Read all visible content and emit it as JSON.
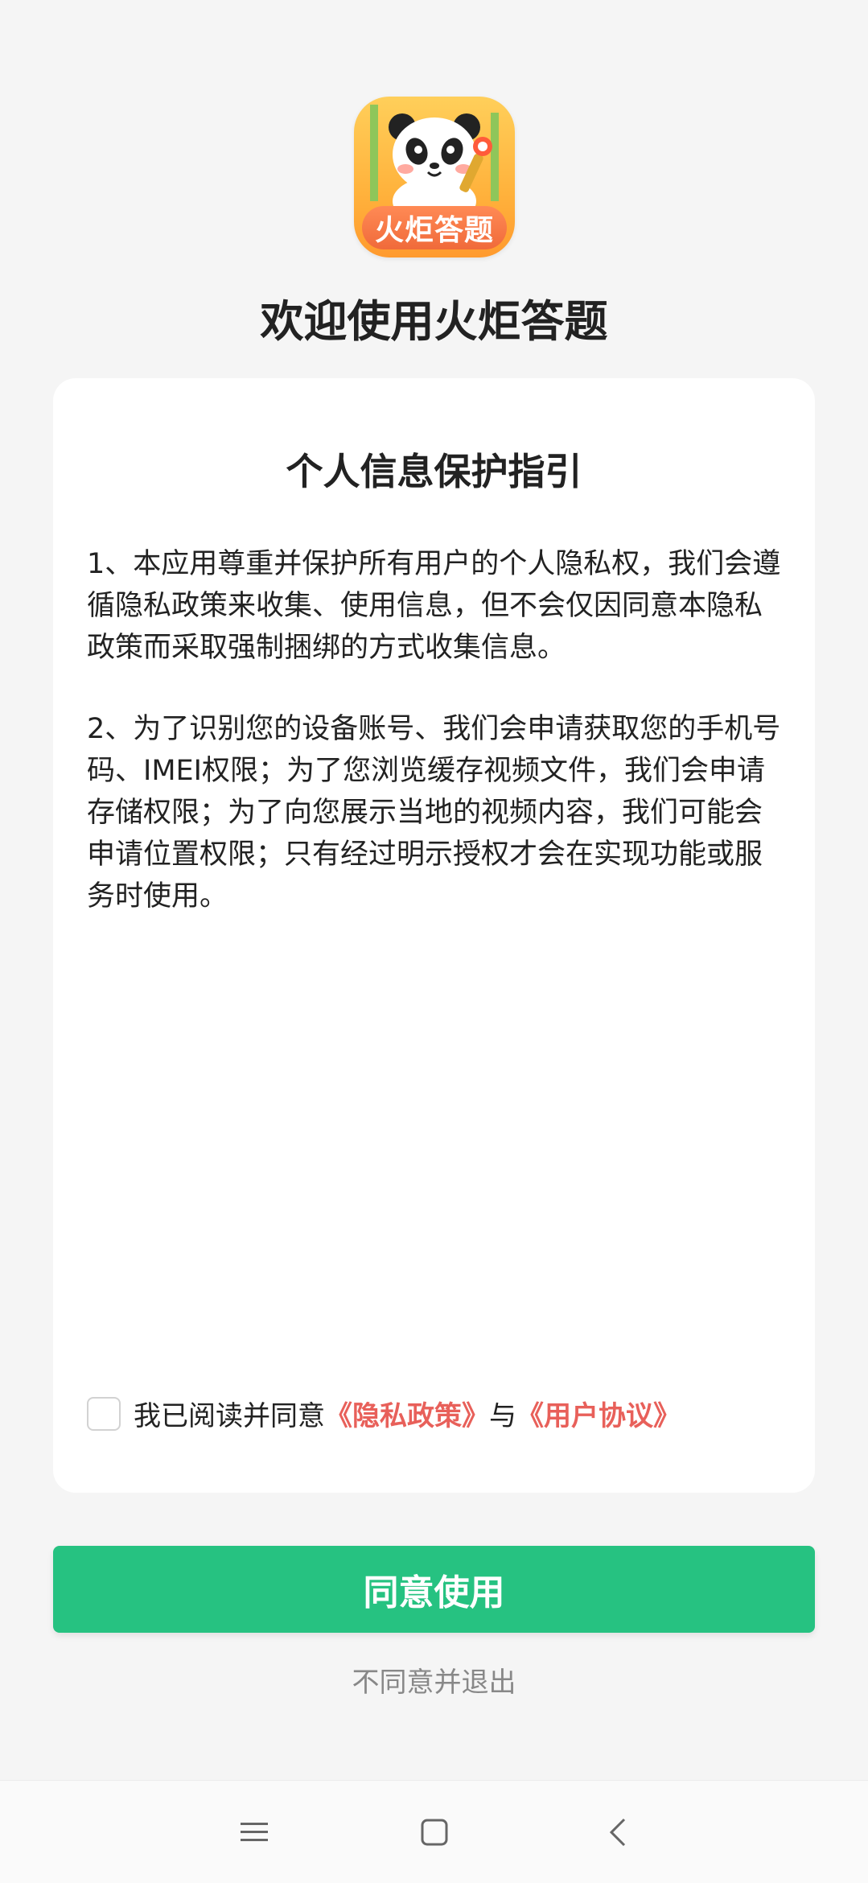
{
  "app": {
    "icon_banner_text": "火炬答题",
    "welcome_title": "欢迎使用火炬答题"
  },
  "card": {
    "title": "个人信息保护指引",
    "paragraph1": "1、本应用尊重并保护所有用户的个人隐私权，我们会遵循隐私政策来收集、使用信息，但不会仅因同意本隐私政策而采取强制捆绑的方式收集信息。",
    "paragraph2": "2、为了识别您的设备账号、我们会申请获取您的手机号码、IMEI权限；为了您浏览缓存视频文件，我们会申请存储权限；为了向您展示当地的视频内容，我们可能会申请位置权限；只有经过明示授权才会在实现功能或服务时使用。",
    "agree_prefix": "我已阅读并同意",
    "privacy_link": "《隐私政策》",
    "connector": "与",
    "user_agreement_link": "《用户协议》",
    "checkbox_checked": false
  },
  "actions": {
    "agree_button": "同意使用",
    "decline_link": "不同意并退出"
  },
  "navbar": {
    "menu_icon": "menu-icon",
    "home_icon": "home-icon",
    "back_icon": "back-icon"
  },
  "colors": {
    "accent_green": "#26c281",
    "link_red": "#e8605a",
    "background": "#f5f5f5"
  }
}
